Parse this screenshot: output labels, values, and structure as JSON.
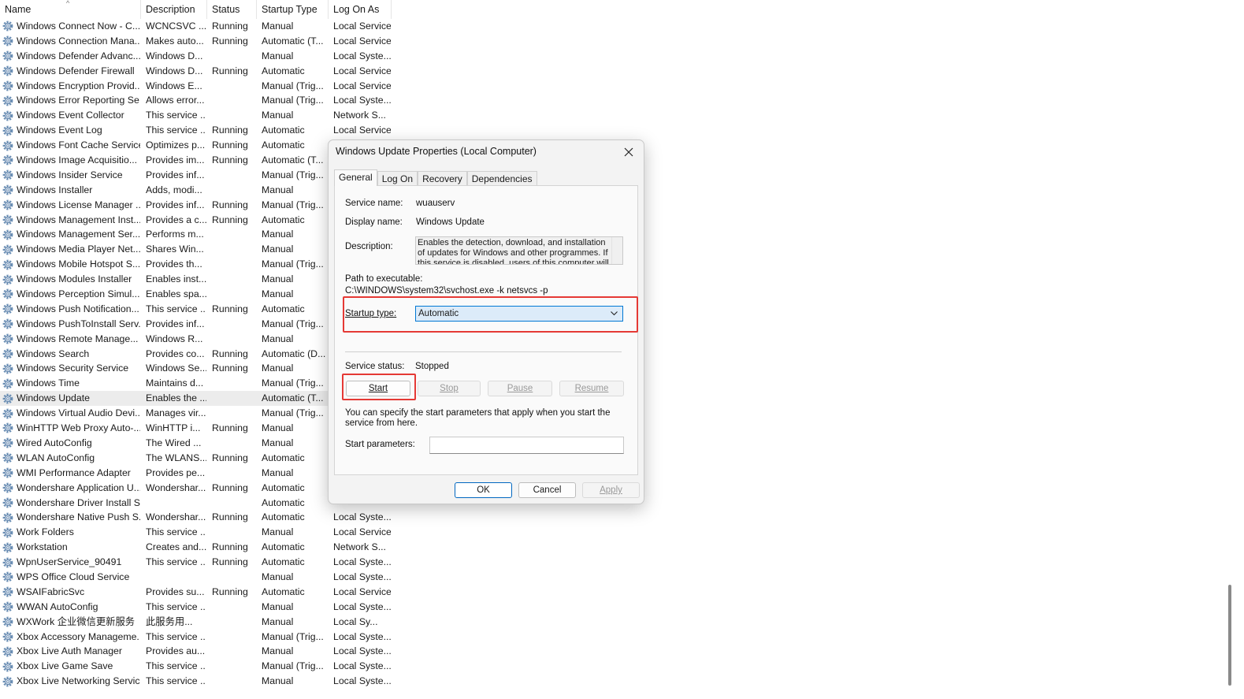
{
  "columns": {
    "name": "Name",
    "description": "Description",
    "status": "Status",
    "startup_type": "Startup Type",
    "log_on_as": "Log On As"
  },
  "services": [
    {
      "name": "Windows Connect Now - C...",
      "description": "WCNCSVC ...",
      "status": "Running",
      "startup_type": "Manual",
      "log_on_as": "Local Service"
    },
    {
      "name": "Windows Connection Mana...",
      "description": "Makes auto...",
      "status": "Running",
      "startup_type": "Automatic (T...",
      "log_on_as": "Local Service"
    },
    {
      "name": "Windows Defender Advanc...",
      "description": "Windows D...",
      "status": "",
      "startup_type": "Manual",
      "log_on_as": "Local Syste..."
    },
    {
      "name": "Windows Defender Firewall",
      "description": "Windows D...",
      "status": "Running",
      "startup_type": "Automatic",
      "log_on_as": "Local Service"
    },
    {
      "name": "Windows Encryption Provid...",
      "description": "Windows E...",
      "status": "",
      "startup_type": "Manual (Trig...",
      "log_on_as": "Local Service"
    },
    {
      "name": "Windows Error Reporting Se...",
      "description": "Allows error...",
      "status": "",
      "startup_type": "Manual (Trig...",
      "log_on_as": "Local Syste..."
    },
    {
      "name": "Windows Event Collector",
      "description": "This service ...",
      "status": "",
      "startup_type": "Manual",
      "log_on_as": "Network S..."
    },
    {
      "name": "Windows Event Log",
      "description": "This service ...",
      "status": "Running",
      "startup_type": "Automatic",
      "log_on_as": "Local Service"
    },
    {
      "name": "Windows Font Cache Service",
      "description": "Optimizes p...",
      "status": "Running",
      "startup_type": "Automatic",
      "log_on_as": ""
    },
    {
      "name": "Windows Image Acquisitio...",
      "description": "Provides im...",
      "status": "Running",
      "startup_type": "Automatic (T...",
      "log_on_as": ""
    },
    {
      "name": "Windows Insider Service",
      "description": "Provides inf...",
      "status": "",
      "startup_type": "Manual (Trig...",
      "log_on_as": ""
    },
    {
      "name": "Windows Installer",
      "description": "Adds, modi...",
      "status": "",
      "startup_type": "Manual",
      "log_on_as": ""
    },
    {
      "name": "Windows License Manager ...",
      "description": "Provides inf...",
      "status": "Running",
      "startup_type": "Manual (Trig...",
      "log_on_as": ""
    },
    {
      "name": "Windows Management Inst...",
      "description": "Provides a c...",
      "status": "Running",
      "startup_type": "Automatic",
      "log_on_as": ""
    },
    {
      "name": "Windows Management Ser...",
      "description": "Performs m...",
      "status": "",
      "startup_type": "Manual",
      "log_on_as": ""
    },
    {
      "name": "Windows Media Player Net...",
      "description": "Shares Win...",
      "status": "",
      "startup_type": "Manual",
      "log_on_as": ""
    },
    {
      "name": "Windows Mobile Hotspot S...",
      "description": "Provides th...",
      "status": "",
      "startup_type": "Manual (Trig...",
      "log_on_as": ""
    },
    {
      "name": "Windows Modules Installer",
      "description": "Enables inst...",
      "status": "",
      "startup_type": "Manual",
      "log_on_as": ""
    },
    {
      "name": "Windows Perception Simul...",
      "description": "Enables spa...",
      "status": "",
      "startup_type": "Manual",
      "log_on_as": ""
    },
    {
      "name": "Windows Push Notification...",
      "description": "This service ...",
      "status": "Running",
      "startup_type": "Automatic",
      "log_on_as": ""
    },
    {
      "name": "Windows PushToInstall Serv...",
      "description": "Provides inf...",
      "status": "",
      "startup_type": "Manual (Trig...",
      "log_on_as": ""
    },
    {
      "name": "Windows Remote Manage...",
      "description": "Windows R...",
      "status": "",
      "startup_type": "Manual",
      "log_on_as": ""
    },
    {
      "name": "Windows Search",
      "description": "Provides co...",
      "status": "Running",
      "startup_type": "Automatic (D...",
      "log_on_as": ""
    },
    {
      "name": "Windows Security Service",
      "description": "Windows Se...",
      "status": "Running",
      "startup_type": "Manual",
      "log_on_as": ""
    },
    {
      "name": "Windows Time",
      "description": "Maintains d...",
      "status": "",
      "startup_type": "Manual (Trig...",
      "log_on_as": ""
    },
    {
      "name": "Windows Update",
      "description": "Enables the ...",
      "status": "",
      "startup_type": "Automatic (T...",
      "log_on_as": "",
      "selected": true
    },
    {
      "name": "Windows Virtual Audio Devi...",
      "description": "Manages vir...",
      "status": "",
      "startup_type": "Manual (Trig...",
      "log_on_as": ""
    },
    {
      "name": "WinHTTP Web Proxy Auto-...",
      "description": "WinHTTP i...",
      "status": "Running",
      "startup_type": "Manual",
      "log_on_as": ""
    },
    {
      "name": "Wired AutoConfig",
      "description": "The Wired ...",
      "status": "",
      "startup_type": "Manual",
      "log_on_as": ""
    },
    {
      "name": "WLAN AutoConfig",
      "description": "The WLANS...",
      "status": "Running",
      "startup_type": "Automatic",
      "log_on_as": ""
    },
    {
      "name": "WMI Performance Adapter",
      "description": "Provides pe...",
      "status": "",
      "startup_type": "Manual",
      "log_on_as": ""
    },
    {
      "name": "Wondershare Application U...",
      "description": "Wondershar...",
      "status": "Running",
      "startup_type": "Automatic",
      "log_on_as": ""
    },
    {
      "name": "Wondershare Driver Install S...",
      "description": "",
      "status": "",
      "startup_type": "Automatic",
      "log_on_as": ""
    },
    {
      "name": "Wondershare Native Push S...",
      "description": "Wondershar...",
      "status": "Running",
      "startup_type": "Automatic",
      "log_on_as": "Local Syste..."
    },
    {
      "name": "Work Folders",
      "description": "This service ...",
      "status": "",
      "startup_type": "Manual",
      "log_on_as": "Local Service"
    },
    {
      "name": "Workstation",
      "description": "Creates and...",
      "status": "Running",
      "startup_type": "Automatic",
      "log_on_as": "Network S..."
    },
    {
      "name": "WpnUserService_90491",
      "description": "This service ...",
      "status": "Running",
      "startup_type": "Automatic",
      "log_on_as": "Local Syste..."
    },
    {
      "name": "WPS Office Cloud Service",
      "description": "",
      "status": "",
      "startup_type": "Manual",
      "log_on_as": "Local Syste..."
    },
    {
      "name": "WSAIFabricSvc",
      "description": "Provides su...",
      "status": "Running",
      "startup_type": "Automatic",
      "log_on_as": "Local Service"
    },
    {
      "name": "WWAN AutoConfig",
      "description": "This service ...",
      "status": "",
      "startup_type": "Manual",
      "log_on_as": "Local Syste..."
    },
    {
      "name": "WXWork 企业微信更新服务",
      "description": "此服务用...",
      "status": "",
      "startup_type": "Manual",
      "log_on_as": "Local Sy..."
    },
    {
      "name": "Xbox Accessory Manageme...",
      "description": "This service ...",
      "status": "",
      "startup_type": "Manual (Trig...",
      "log_on_as": "Local Syste..."
    },
    {
      "name": "Xbox Live Auth Manager",
      "description": "Provides au...",
      "status": "",
      "startup_type": "Manual",
      "log_on_as": "Local Syste..."
    },
    {
      "name": "Xbox Live Game Save",
      "description": "This service ...",
      "status": "",
      "startup_type": "Manual (Trig...",
      "log_on_as": "Local Syste..."
    },
    {
      "name": "Xbox Live Networking Service",
      "description": "This service ...",
      "status": "",
      "startup_type": "Manual",
      "log_on_as": "Local Syste..."
    }
  ],
  "dialog": {
    "title": "Windows Update Properties (Local Computer)",
    "tabs": [
      "General",
      "Log On",
      "Recovery",
      "Dependencies"
    ],
    "service_name_label": "Service name:",
    "service_name": "wuauserv",
    "display_name_label": "Display name:",
    "display_name": "Windows Update",
    "description_label": "Description:",
    "description": "Enables the detection, download, and installation of updates for Windows and other programmes. If this service is disabled, users of this computer will not be",
    "path_label": "Path to executable:",
    "path": "C:\\WINDOWS\\system32\\svchost.exe -k netsvcs -p",
    "startup_type_label": "Startup type:",
    "startup_type": "Automatic",
    "service_status_label": "Service status:",
    "service_status": "Stopped",
    "buttons": {
      "start": "Start",
      "stop": "Stop",
      "pause": "Pause",
      "resume": "Resume"
    },
    "hint": "You can specify the start parameters that apply when you start the service from here.",
    "start_params_label": "Start parameters:",
    "start_params_value": "",
    "footer": {
      "ok": "OK",
      "cancel": "Cancel",
      "apply": "Apply"
    }
  },
  "highlight_color": "#e53935",
  "accent_color": "#0078d4"
}
